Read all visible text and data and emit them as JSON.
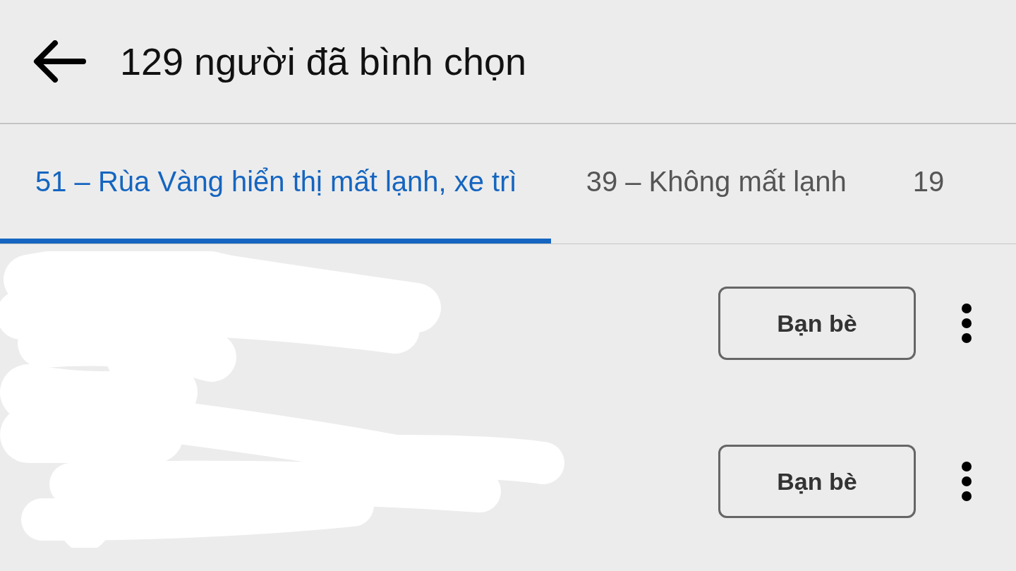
{
  "header": {
    "title": "129 người đã bình chọn"
  },
  "tabs": [
    {
      "label": "51 – Rùa Vàng hiển thị mất lạnh, xe trì",
      "selected": true
    },
    {
      "label": "39 – Không mất lạnh",
      "selected": false
    },
    {
      "label": "19",
      "selected": false
    }
  ],
  "voters": [
    {
      "button_label": "Bạn bè"
    },
    {
      "button_label": "Bạn bè"
    }
  ]
}
